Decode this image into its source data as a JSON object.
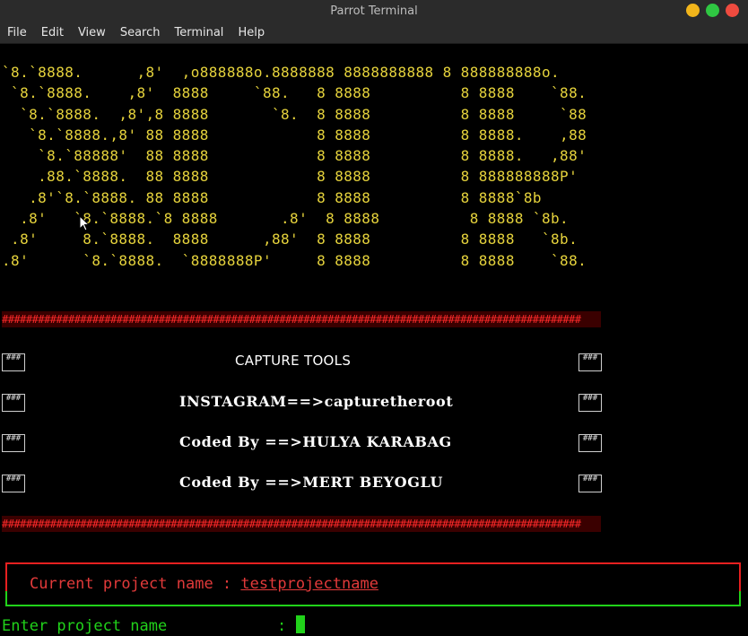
{
  "window": {
    "title": "Parrot Terminal",
    "colors": {
      "close": "#ef4b3f",
      "maximize": "#2fc742",
      "minimize": "#f2b51b"
    }
  },
  "menu": [
    "File",
    "Edit",
    "View",
    "Search",
    "Terminal",
    "Help"
  ],
  "banner": {
    "color": "#e6d33c",
    "lines": [
      "`8.`8888.      ,8'  ,o888888o.8888888 8888888888 8 888888888o.",
      " `8.`8888.    ,8'  8888     `88.   8 8888          8 8888    `88.",
      "  `8.`8888.  ,8',8 8888       `8.  8 8888          8 8888     `88",
      "   `8.`8888.,8' 88 8888            8 8888          8 8888.    ,88",
      "    `8.`88888'  88 8888            8 8888          8 8888.   ,88'",
      "    .88.`8888.  88 8888            8 8888          8 888888888P'",
      "   .8'`8.`8888. 88 8888            8 8888          8 8888`8b",
      "  .8'   `8.`8888.`8 8888       .8'  8 8888          8 8888 `8b.",
      " .8'     8.`8888.  8888      ,88'  8 8888          8 8888   `8b.",
      ".8'      `8.`8888.  `8888888P'     8 8888          8 8888    `88."
    ]
  },
  "capture": {
    "hash_row": "################################################################################################",
    "pillar": "###",
    "title": "CAPTURE TOOLS",
    "rows": [
      "INSTAGRAM==>capturetheroot",
      "Coded By ==>HULYA KARABAG",
      "Coded By ==>MERT BEYOGLU"
    ]
  },
  "project": {
    "current_label": "Current project name : ",
    "current_value": "testprojectname",
    "prompt_label": "Enter project name            : "
  },
  "icons": {
    "pointer": "mouse-pointer-icon"
  },
  "colors": {
    "banner": "#e6d33c",
    "hash": "#ff2a2a",
    "current": "#e23a3a",
    "prompt": "#21d21a",
    "red_border": "#e62020",
    "green_border": "#21d21a"
  }
}
